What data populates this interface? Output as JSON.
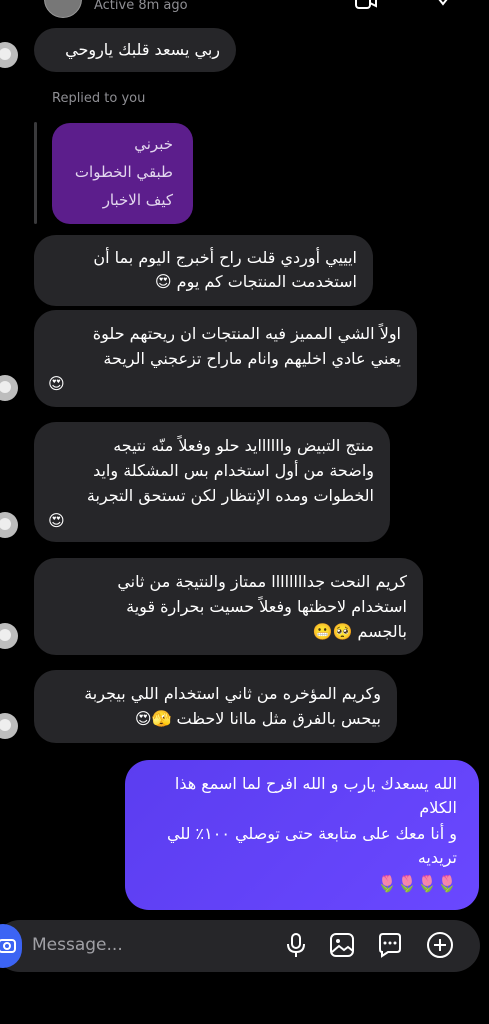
{
  "header": {
    "status": "Active 8m ago"
  },
  "thread": {
    "msg1": "ربي يسعد قلبك ياروحي",
    "replied_label": "Replied to you",
    "reply_lines": [
      "خبرني",
      "طبقي الخطوات",
      "كيف الاخبار"
    ],
    "msg2": [
      "ايييي أوردي قلت راح أخبرج اليوم بما أن",
      "استخدمت المنتجات كم يوم 😍"
    ],
    "msg3": [
      "اولاً الشي المميز فيه المنتجات ان ريحتهم حلوة",
      "يعني عادي اخليهم وانام ماراح تزعجني الريحة",
      "😍"
    ],
    "msg4": [
      "منتج التبيض واااااايد حلو وفعلاً منّه نتيجه",
      "واضحة من أول استخدام بس المشكلة وايد",
      "الخطوات ومده الإنتظار لكن تستحق التجربة",
      "😍"
    ],
    "msg5": [
      "كريم النحت جداااااااا ممتاز والنتيجة من ثاني",
      "استخدام لاحظتها وفعلاً حسيت بحرارة قوية",
      "بالجسم 🥺😬"
    ],
    "msg6": [
      "وكريم المؤخره من ثاني استخدام اللي بيجربة",
      "بيحس بالفرق مثل ماانا لاحظت 🫣😍"
    ],
    "sent": [
      "الله يسعدك يارب و الله افرح لما اسمع هذا",
      "الكلام",
      "و أنا معك على متابعة حتى توصلي ١٠٠٪ للي",
      "تريديه",
      "🌷🌷🌷🌷"
    ]
  },
  "composer": {
    "placeholder": "Message..."
  },
  "icons": {
    "composer": [
      "camera-icon",
      "microphone-icon",
      "gallery-icon",
      "sticker-icon",
      "plus-icon"
    ],
    "accent": "#3c64f4",
    "sent_bubble": "#6245f5",
    "reply_bubble": "#5c1e8c"
  }
}
